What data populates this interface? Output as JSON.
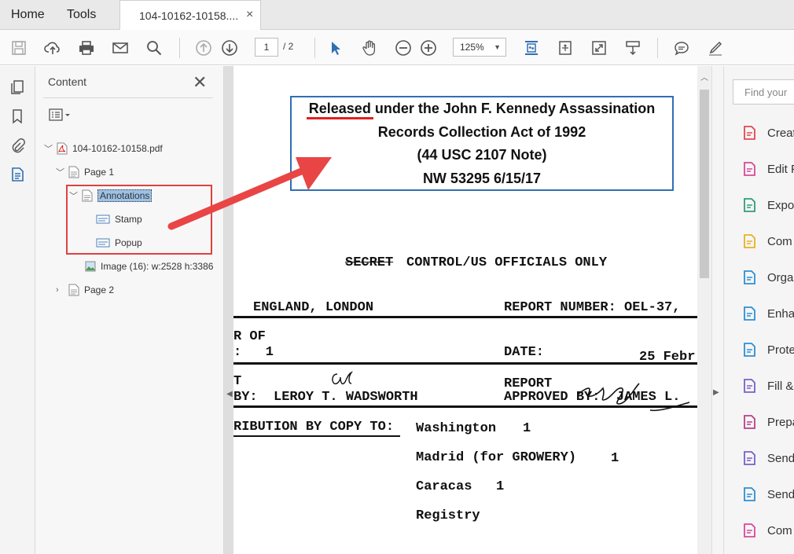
{
  "menubar": {
    "home": "Home",
    "tools": "Tools"
  },
  "doc_tab": {
    "title": "104-10162-10158....",
    "close": "×"
  },
  "toolbar": {
    "page_current": "1",
    "page_total": "/ 2",
    "zoom": "125%"
  },
  "nav_panel": {
    "title": "Content",
    "tree": {
      "file": "104-10162-10158.pdf",
      "page1": "Page 1",
      "annotations": "Annotations",
      "stamp": "Stamp",
      "popup": "Popup",
      "image": "Image (16): w:2528 h:3386",
      "page2": "Page 2"
    }
  },
  "stamp": {
    "line1_a": "Released",
    "line1_b": " under the John F. Kennedy Assassination",
    "line2": "Records Collection Act of 1992",
    "line3": "(44 USC 2107 Note)",
    "line4": "NW 53295 6/15/17"
  },
  "document": {
    "heading": "CONTROL/US OFFICIALS ONLY",
    "struck": "SECRET",
    "l1_left": "ENGLAND, LONDON",
    "l1_right": "REPORT NUMBER: OEL-37,",
    "l2a": "R OF",
    "l2b": ":   1",
    "l2_right_label": "DATE:",
    "l2_right_val": "25 Febr",
    "l3_left_a": "T",
    "l3_left_b": "BY:  LEROY T. WADSWORTH",
    "l3_right_a": "REPORT",
    "l3_right_b": "APPROVED BY:  JAMES L.",
    "dist_label": "RIBUTION BY COPY TO:",
    "dist": [
      {
        "place": "Washington",
        "count": "1"
      },
      {
        "place": "Madrid (for GROWERY)",
        "count": "1"
      },
      {
        "place": "Caracas",
        "count": "1"
      },
      {
        "place": "Registry",
        "count": ""
      }
    ]
  },
  "right_pane": {
    "find_placeholder": "Find your",
    "tools": [
      {
        "label": "Creat",
        "icon": "create-pdf-icon",
        "color": "#e34850"
      },
      {
        "label": "Edit P",
        "icon": "edit-pdf-icon",
        "color": "#d9489a"
      },
      {
        "label": "Expo",
        "icon": "export-pdf-icon",
        "color": "#2e9e77"
      },
      {
        "label": "Com",
        "icon": "comment-icon",
        "color": "#e8b220"
      },
      {
        "label": "Orga",
        "icon": "organize-pages-icon",
        "color": "#2d8fd5"
      },
      {
        "label": "Enha",
        "icon": "enhance-scans-icon",
        "color": "#2d8fd5"
      },
      {
        "label": "Prote",
        "icon": "protect-icon",
        "color": "#2d8fd5"
      },
      {
        "label": "Fill &",
        "icon": "fill-sign-icon",
        "color": "#7a5fc8"
      },
      {
        "label": "Prepa",
        "icon": "prepare-form-icon",
        "color": "#b83f8a"
      },
      {
        "label": "Send",
        "icon": "send-for-signature-icon",
        "color": "#7a5fc8"
      },
      {
        "label": "Send",
        "icon": "send-track-icon",
        "color": "#2d8fd5"
      },
      {
        "label": "Com",
        "icon": "compare-icon",
        "color": "#d9489a"
      }
    ]
  },
  "colors": {
    "accent": "#2f6fb3",
    "annotation_red": "#e04040",
    "selection": "#9dc1e6"
  }
}
